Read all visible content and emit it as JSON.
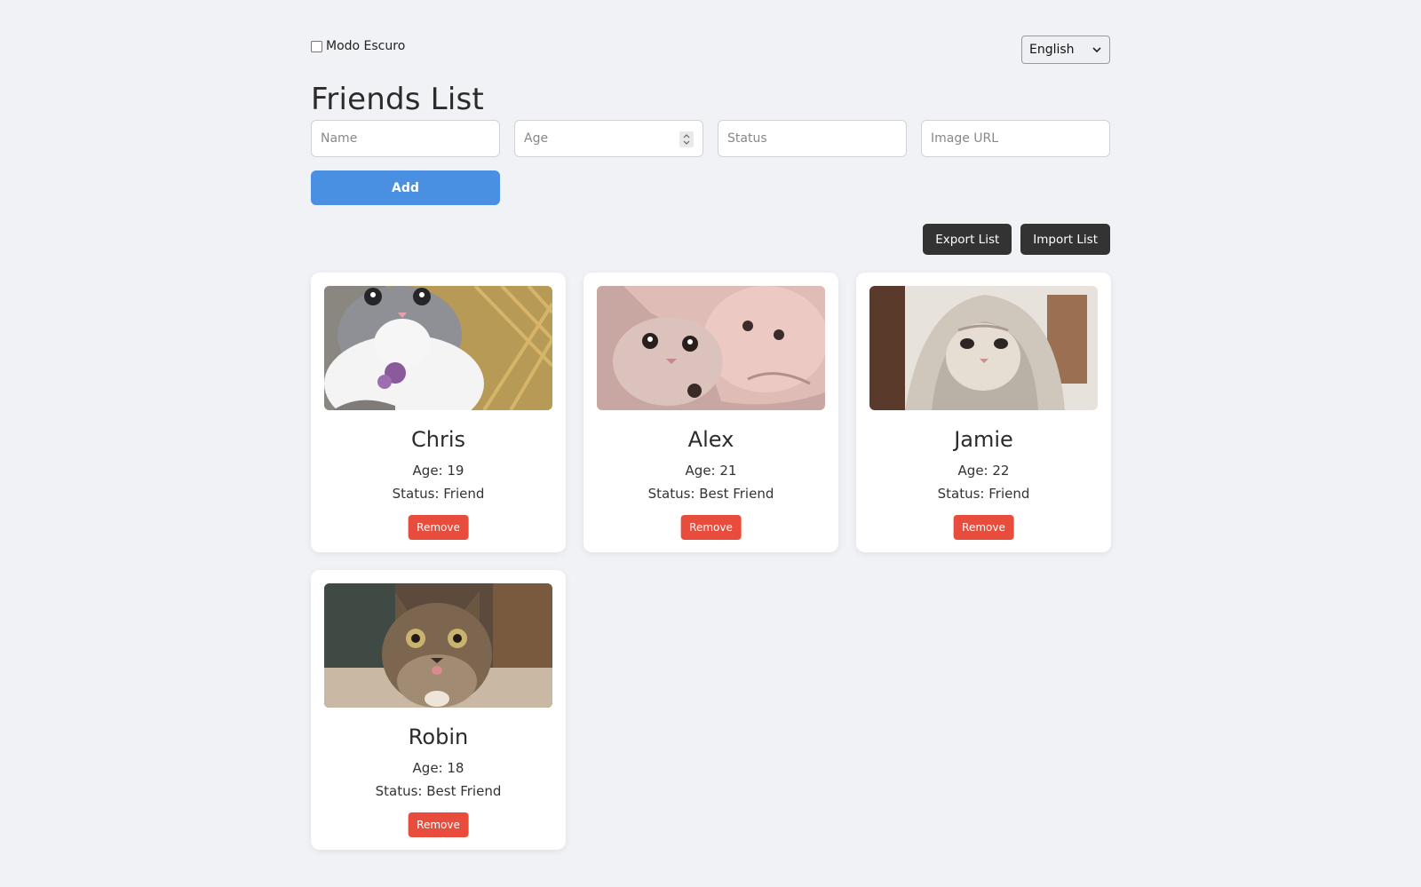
{
  "top": {
    "dark_mode_label": "Modo Escuro",
    "language": "English"
  },
  "title": "Friends List",
  "form": {
    "name_placeholder": "Name",
    "age_placeholder": "Age",
    "status_placeholder": "Status",
    "image_placeholder": "Image URL",
    "add_label": "Add"
  },
  "actions": {
    "export_label": "Export List",
    "import_label": "Import List"
  },
  "friends": [
    {
      "name": "Chris",
      "age": "Age: 19",
      "status": "Status: Friend",
      "remove": "Remove",
      "image_icon": "gray-white-kitten-photo"
    },
    {
      "name": "Alex",
      "age": "Age: 21",
      "status": "Status: Best Friend",
      "remove": "Remove",
      "image_icon": "kitten-in-pink-hood-photo"
    },
    {
      "name": "Jamie",
      "age": "Age: 22",
      "status": "Status: Friend",
      "remove": "Remove",
      "image_icon": "kitten-in-blanket-photo"
    },
    {
      "name": "Robin",
      "age": "Age: 18",
      "status": "Status: Best Friend",
      "remove": "Remove",
      "image_icon": "tabby-cat-photo"
    }
  ],
  "colors": {
    "background": "#f0f2f6",
    "primary": "#4a90e2",
    "danger": "#e74c3c",
    "dark_button": "#333333"
  }
}
